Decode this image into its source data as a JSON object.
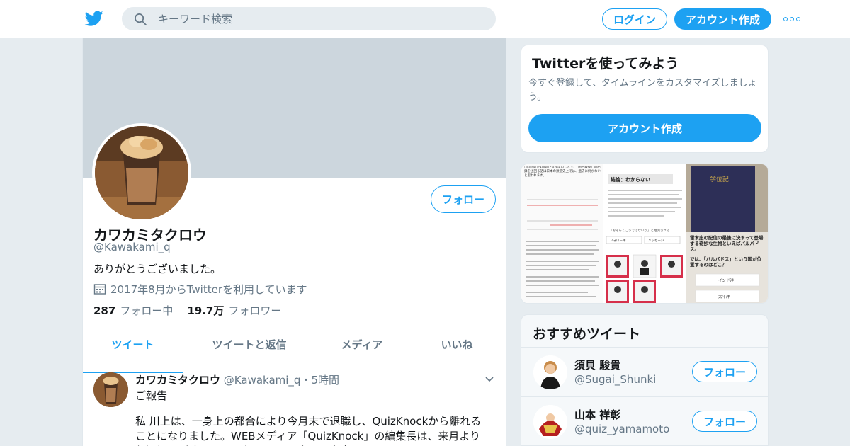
{
  "colors": {
    "brand": "#1da1f2",
    "muted": "#657786",
    "text": "#14171a",
    "banner": "#ccd6dd"
  },
  "header": {
    "logo_icon": "twitter-bird-icon",
    "search": {
      "placeholder": "キーワード検索",
      "icon": "search-icon"
    },
    "login_label": "ログイン",
    "signup_label": "アカウント作成",
    "more_icon": "more-dots-icon"
  },
  "profile": {
    "name": "カワカミタクロウ",
    "handle": "@Kawakami_q",
    "bio": "ありがとうございました。",
    "joined": "2017年8月からTwitterを利用しています",
    "follow_label": "フォロー",
    "stats": {
      "following_count": "287",
      "following_label": "フォロー中",
      "followers_count": "19.7万",
      "followers_label": "フォロワー"
    }
  },
  "tabs": [
    {
      "label": "ツイート",
      "active": true
    },
    {
      "label": "ツイートと返信",
      "active": false
    },
    {
      "label": "メディア",
      "active": false
    },
    {
      "label": "いいね",
      "active": false
    }
  ],
  "tweet": {
    "name": "カワカミタクロウ",
    "handle": "@Kawakami_q",
    "separator": "・",
    "time": "5時間",
    "first_line": "ご報告",
    "body": "私 川上は、一身上の都合により今月末で退職し、QuizKnockから離れることになりました。WEBメディア「QuizKnock」の編集長は、来月より伊沢拓司が務めます。今までありがとうございました。"
  },
  "signup_card": {
    "title": "Twitterを使ってみよう",
    "description": "今すぐ登録して、タイムラインをカスタマイズしましょう。",
    "button_label": "アカウント作成"
  },
  "media_thumbs": {
    "thumb1": {
      "header": "○の時間が1日延びる程度のことで、「国内最長」の記録を上回る話は日本の鉄道史上では、過去に例がないと思われます。"
    },
    "thumb2": {
      "title": "結論：わからない",
      "note": "「おそらくこうではないか」と推測される",
      "follow": "フォロー中",
      "message": "メッセージ"
    },
    "thumb3": {
      "book_title": "学位記",
      "caption": "雷木庄の配信の最後に決まって登場する奇妙な生物といえばバルバドス。",
      "question": "では、「バルバドス」という国が位置するのはどこ？",
      "choice1": "インド洋",
      "choice2": "太平洋"
    }
  },
  "recommended": {
    "title": "おすすめツイート",
    "items": [
      {
        "name": "須貝 駿貴",
        "handle": "@Sugai_Shunki",
        "follow_label": "フォロー"
      },
      {
        "name": "山本 祥彰",
        "handle": "@quiz_yamamoto",
        "follow_label": "フォロー"
      }
    ]
  }
}
